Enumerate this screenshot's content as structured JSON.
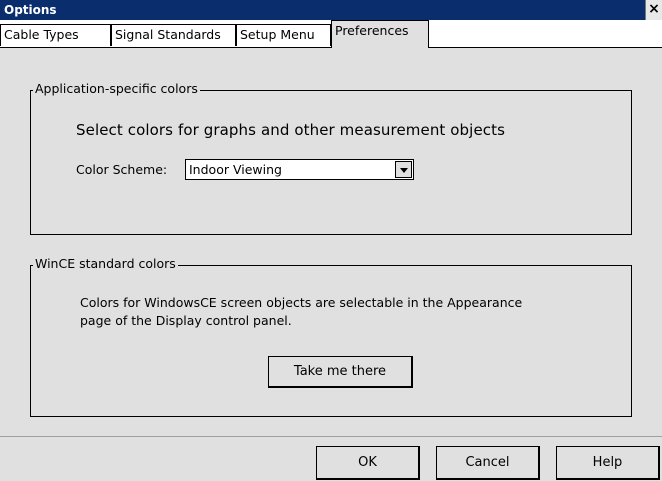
{
  "window": {
    "title": "Options",
    "close_glyph": "×"
  },
  "tabs": [
    {
      "label": "Cable Types"
    },
    {
      "label": "Signal Standards"
    },
    {
      "label": "Setup Menu"
    },
    {
      "label": "Preferences",
      "active": true
    }
  ],
  "app_colors": {
    "legend": "Application-specific colors",
    "heading": "Select colors for graphs and other measurement objects",
    "scheme_label": "Color Scheme:",
    "scheme_value": "Indoor Viewing"
  },
  "wince_colors": {
    "legend": "WinCE standard colors",
    "line1": "Colors for WindowsCE screen objects are selectable in the Appearance",
    "line2": "page of the Display control panel.",
    "button": "Take me there"
  },
  "footer": {
    "ok": "OK",
    "cancel": "Cancel",
    "help": "Help"
  },
  "colors": {
    "titlebar": "#0a2d6e",
    "panel": "#e0e0e0"
  }
}
